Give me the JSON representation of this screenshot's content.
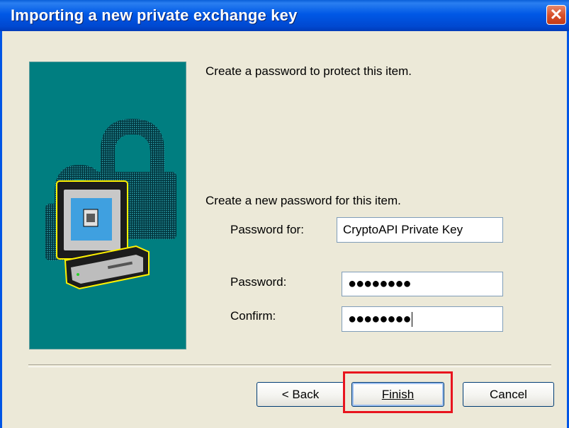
{
  "window": {
    "title": "Importing a new private exchange key",
    "close_glyph": "✕"
  },
  "content": {
    "intro_text": "Create a password to protect this item.",
    "section_text": "Create a new password for this item.",
    "password_for_label": "Password for:",
    "password_for_value": "CryptoAPI Private Key",
    "password_label": "Password:",
    "password_value": "●●●●●●●●",
    "confirm_label": "Confirm:",
    "confirm_value": "●●●●●●●●"
  },
  "buttons": {
    "back_label": "< Back",
    "finish_label": "Finish",
    "cancel_label": "Cancel"
  },
  "icons": {
    "close": "close-icon",
    "illustration": "computer-padlock-icon"
  },
  "colors": {
    "title_bar": "#0055E5",
    "side_panel": "#007E80",
    "dialog_bg": "#ECE9D8",
    "highlight": "#E8141E"
  }
}
